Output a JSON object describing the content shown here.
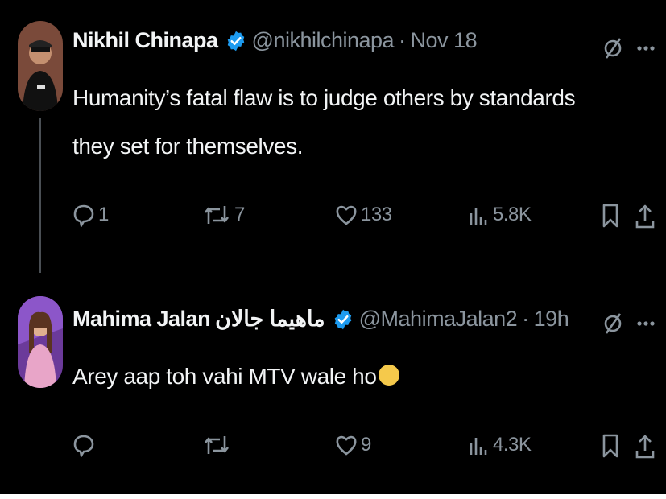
{
  "tweets": [
    {
      "name": "Nikhil Chinapa",
      "handle": "@nikhilchinapa",
      "separator": "·",
      "time": "Nov 18",
      "text": "Humanity’s fatal flaw is to judge others by standards they set for themselves.",
      "replies": "1",
      "retweets": "7",
      "likes": "133",
      "views": "5.8K",
      "verified": true
    },
    {
      "name": "Mahima Jalan",
      "name_extra": "ماھیما جالان",
      "handle": "@MahimaJalan2",
      "separator": "·",
      "time": "19h",
      "text": "Arey aap toh vahi MTV wale ho",
      "replies": "",
      "retweets": "",
      "likes": "9",
      "views": "4.3K",
      "verified": true
    }
  ],
  "colors": {
    "background": "#000000",
    "text": "#e7e9ea",
    "muted": "#8b959e",
    "verified": "#1d9bf0",
    "thread_line": "#4a4f54"
  },
  "icons": [
    "grok-icon",
    "more-icon",
    "reply-icon",
    "retweet-icon",
    "like-icon",
    "views-icon",
    "bookmark-icon",
    "share-icon",
    "verified-badge-icon"
  ]
}
